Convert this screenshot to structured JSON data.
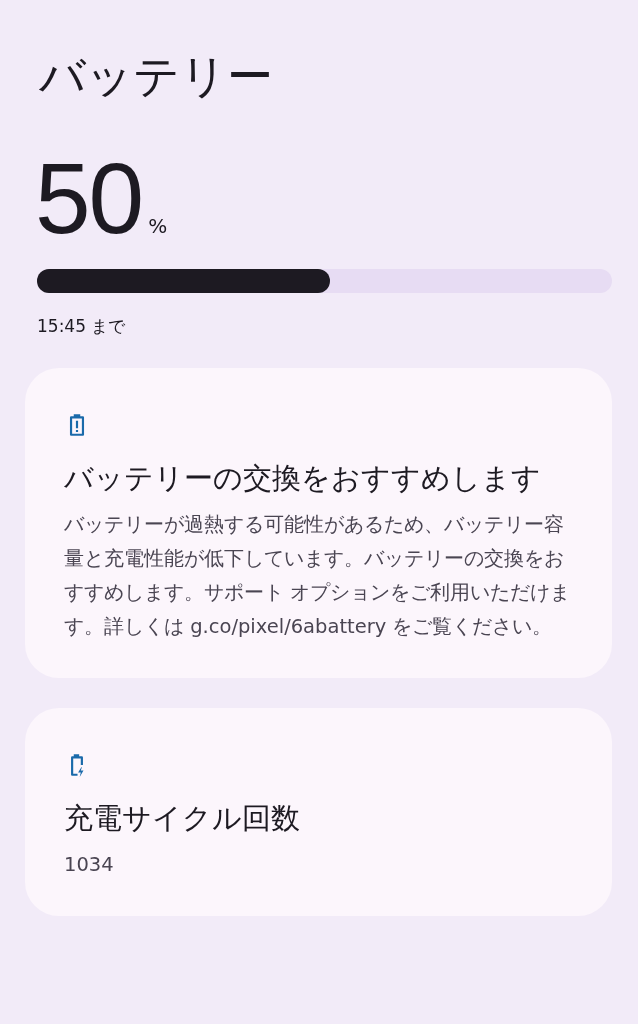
{
  "title": "バッテリー",
  "battery": {
    "percent": "50",
    "unit": "%",
    "level": 0.51,
    "until": "15:45 まで"
  },
  "cards": [
    {
      "kind": "alert",
      "title": "バッテリーの交換をおすすめします",
      "body": "バッテリーが過熱する可能性があるため、バッテリー容量と充電性能が低下しています。バッテリーの交換をおすすめします。サポート オプションをご利用いただけます。詳しくは g.co/pixel/6abattery をご覧ください。"
    },
    {
      "kind": "charging",
      "title": "充電サイクル回数",
      "body": "1034"
    }
  ]
}
